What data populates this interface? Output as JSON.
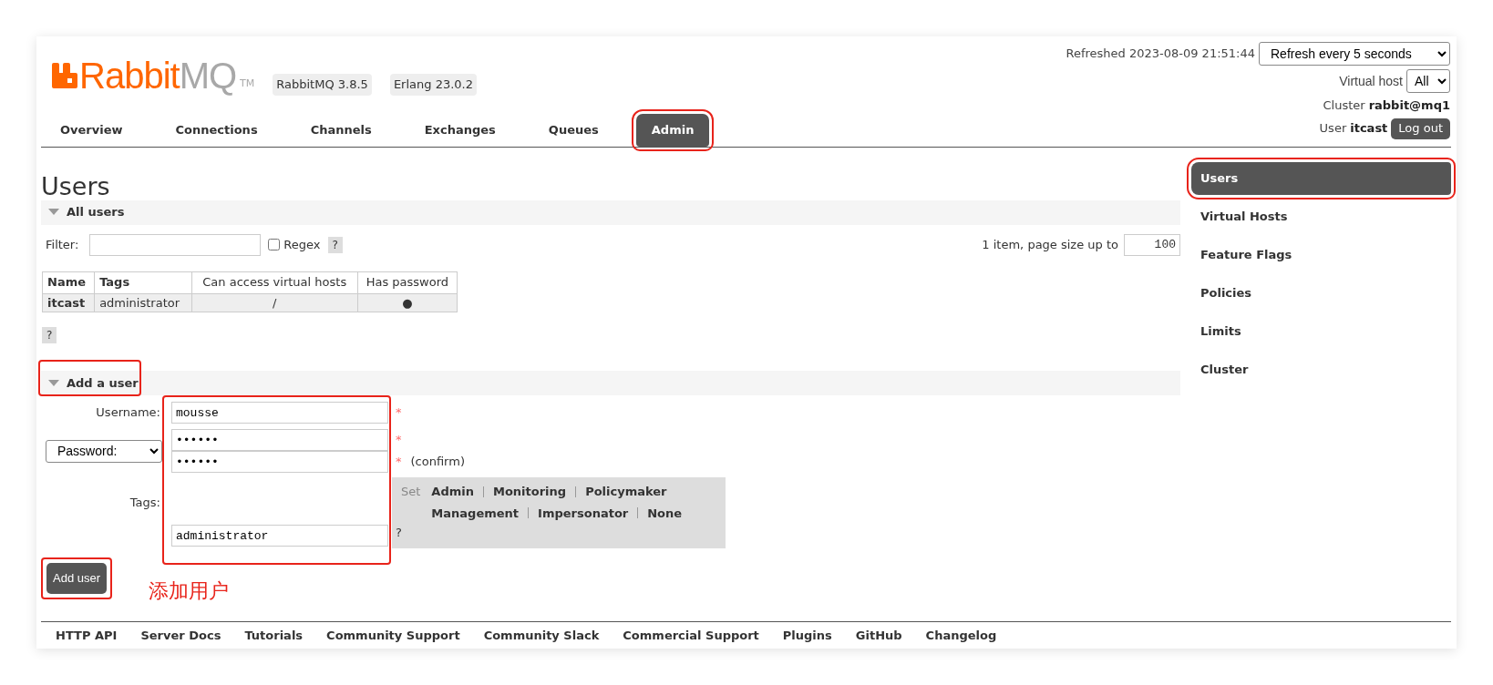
{
  "header": {
    "logo_a": "Rabbit",
    "logo_b": "MQ",
    "trademark": "TM",
    "badges": [
      "RabbitMQ 3.8.5",
      "Erlang 23.0.2"
    ],
    "refreshed": "Refreshed 2023-08-09 21:51:44",
    "refresh_select": "Refresh every 5 seconds",
    "vhost_label": "Virtual host",
    "vhost_select": "All",
    "cluster_label": "Cluster",
    "cluster_name": "rabbit@mq1",
    "user_label": "User",
    "user_name": "itcast",
    "logout": "Log out"
  },
  "tabs": [
    {
      "label": "Overview",
      "selected": false,
      "highlighted": false
    },
    {
      "label": "Connections",
      "selected": false,
      "highlighted": false
    },
    {
      "label": "Channels",
      "selected": false,
      "highlighted": false
    },
    {
      "label": "Exchanges",
      "selected": false,
      "highlighted": false
    },
    {
      "label": "Queues",
      "selected": false,
      "highlighted": false
    },
    {
      "label": "Admin",
      "selected": true,
      "highlighted": true
    }
  ],
  "page_title": "Users",
  "all_users": {
    "title": "All users",
    "expanded": true,
    "filter_label": "Filter:",
    "regex_label": "Regex",
    "regex_checked": false,
    "help": "?",
    "paging": "1 item, page size up to",
    "page_size": "100",
    "table": {
      "columns": [
        "Name",
        "Tags",
        "Can access virtual hosts",
        "Has password"
      ],
      "rows": [
        [
          "itcast",
          "administrator",
          "/",
          "●"
        ]
      ]
    },
    "help_below": "?"
  },
  "add_user": {
    "title": "Add a user",
    "expanded": true,
    "highlighted": true,
    "username_label": "Username:",
    "username": "mousse",
    "username_required": "*",
    "password_select": "Password:",
    "password": "••••••",
    "password_required": "*",
    "confirm": "••••••",
    "confirm_required": "*",
    "confirm_note": "(confirm)",
    "tags_label": "Tags:",
    "set_label": "Set",
    "tag_options": [
      [
        "Admin",
        "Monitoring",
        "Policymaker"
      ],
      [
        "Management",
        "Impersonator",
        "None"
      ]
    ],
    "tags": "administrator",
    "tags_help": "?",
    "fields_highlighted": true,
    "button": {
      "label": "Add user",
      "highlighted": true
    },
    "note": "添加用户"
  },
  "sidebar": [
    {
      "label": "Users",
      "selected": true,
      "highlighted": true
    },
    {
      "label": "Virtual Hosts",
      "selected": false,
      "highlighted": false
    },
    {
      "label": "Feature Flags",
      "selected": false,
      "highlighted": false
    },
    {
      "label": "Policies",
      "selected": false,
      "highlighted": false
    },
    {
      "label": "Limits",
      "selected": false,
      "highlighted": false
    },
    {
      "label": "Cluster",
      "selected": false,
      "highlighted": false
    }
  ],
  "footer": [
    "HTTP API",
    "Server Docs",
    "Tutorials",
    "Community Support",
    "Community Slack",
    "Commercial Support",
    "Plugins",
    "GitHub",
    "Changelog"
  ]
}
